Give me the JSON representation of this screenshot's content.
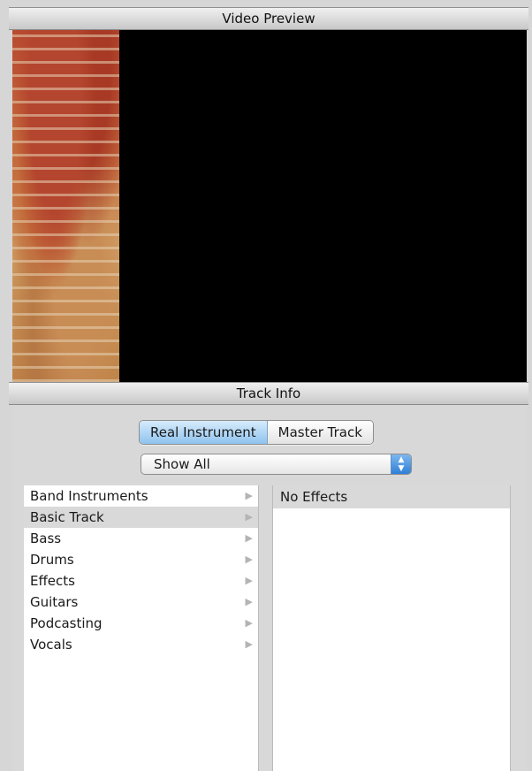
{
  "video_preview": {
    "title": "Video Preview"
  },
  "track_info": {
    "title": "Track Info",
    "segmented": [
      "Real Instrument",
      "Master Track"
    ],
    "popup_value": "Show All",
    "categories": [
      {
        "label": "Band Instruments"
      },
      {
        "label": "Basic Track"
      },
      {
        "label": "Bass"
      },
      {
        "label": "Drums"
      },
      {
        "label": "Effects"
      },
      {
        "label": "Guitars"
      },
      {
        "label": "Podcasting"
      },
      {
        "label": "Vocals"
      }
    ],
    "presets": [
      {
        "label": "No Effects"
      }
    ]
  },
  "colors": {
    "accent": "#8fc3ef",
    "selection": "#d9d9d9"
  },
  "icons": {
    "submenu": "triangle-right-icon",
    "popup": "up-down-arrows-icon"
  }
}
